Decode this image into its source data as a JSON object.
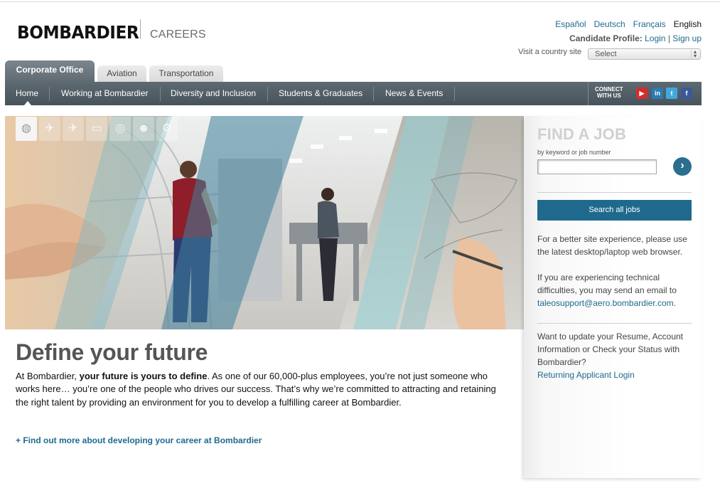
{
  "header": {
    "logo": "BOMBARDIER",
    "section": "CAREERS",
    "languages": [
      "Español",
      "Deutsch",
      "Français",
      "English"
    ],
    "current_language": "English",
    "candidate_label": "Candidate Profile:",
    "login": "Login",
    "divider": "|",
    "signup": "Sign up",
    "country_label": "Visit a country site",
    "country_select": "Select"
  },
  "tabs": [
    {
      "label": "Corporate Office",
      "active": true
    },
    {
      "label": "Aviation",
      "active": false
    },
    {
      "label": "Transportation",
      "active": false
    }
  ],
  "nav": {
    "items": [
      "Home",
      "Working at Bombardier",
      "Diversity and Inclusion",
      "Students & Graduates",
      "News & Events"
    ],
    "connect_line1": "CONNECT",
    "connect_line2": "WITH US",
    "social": [
      {
        "name": "youtube-icon",
        "glyph": "▶",
        "color": "#d32c2c"
      },
      {
        "name": "linkedin-icon",
        "glyph": "in",
        "color": "#2a7cb2"
      },
      {
        "name": "twitter-icon",
        "glyph": "t",
        "color": "#3fa9de"
      },
      {
        "name": "facebook-icon",
        "glyph": "f",
        "color": "#3b5998"
      }
    ]
  },
  "hero_icons": [
    "globe-icon",
    "plane-icon",
    "aircraft-icon",
    "train-icon",
    "world-icon",
    "person-icon",
    "gear-icon"
  ],
  "content": {
    "headline": "Define your future",
    "intro_start": "At Bombardier, ",
    "intro_bold": "your future is yours to define",
    "intro_rest": ". As one of our 60,000-plus employees, you’re not just someone who works here… you’re one of the people who drives our success. That’s why we’re committed to attracting and retaining the right talent by providing an environment for you to develop a fulfilling career at Bombardier.",
    "more_link": "+ Find out more about developing your career at Bombardier"
  },
  "find_job": {
    "title": "FIND A JOB",
    "keyword_label": "by keyword or job number",
    "keyword_value": "",
    "go_glyph": "›",
    "search_all": "Search all jobs",
    "browser_note": "For a better site experience, please use the latest desktop/laptop web browser.",
    "tech_note": "If you are experiencing technical difficulties, you may send an email to ",
    "support_email": "taleosupport@aero.bombardier.com",
    "period": ".",
    "update_note": "Want to update your Resume, Account Information or Check your Status with Bombardier?",
    "returning_link": "Returning Applicant Login"
  }
}
